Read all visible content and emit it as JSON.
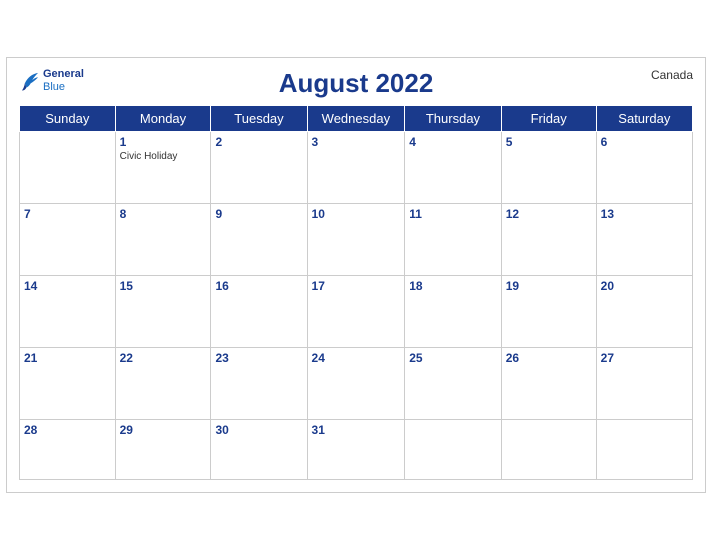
{
  "header": {
    "title": "August 2022",
    "country": "Canada",
    "logo_general": "General",
    "logo_blue": "Blue"
  },
  "days_of_week": [
    "Sunday",
    "Monday",
    "Tuesday",
    "Wednesday",
    "Thursday",
    "Friday",
    "Saturday"
  ],
  "weeks": [
    [
      {
        "date": "",
        "holiday": ""
      },
      {
        "date": "1",
        "holiday": "Civic Holiday"
      },
      {
        "date": "2",
        "holiday": ""
      },
      {
        "date": "3",
        "holiday": ""
      },
      {
        "date": "4",
        "holiday": ""
      },
      {
        "date": "5",
        "holiday": ""
      },
      {
        "date": "6",
        "holiday": ""
      }
    ],
    [
      {
        "date": "7",
        "holiday": ""
      },
      {
        "date": "8",
        "holiday": ""
      },
      {
        "date": "9",
        "holiday": ""
      },
      {
        "date": "10",
        "holiday": ""
      },
      {
        "date": "11",
        "holiday": ""
      },
      {
        "date": "12",
        "holiday": ""
      },
      {
        "date": "13",
        "holiday": ""
      }
    ],
    [
      {
        "date": "14",
        "holiday": ""
      },
      {
        "date": "15",
        "holiday": ""
      },
      {
        "date": "16",
        "holiday": ""
      },
      {
        "date": "17",
        "holiday": ""
      },
      {
        "date": "18",
        "holiday": ""
      },
      {
        "date": "19",
        "holiday": ""
      },
      {
        "date": "20",
        "holiday": ""
      }
    ],
    [
      {
        "date": "21",
        "holiday": ""
      },
      {
        "date": "22",
        "holiday": ""
      },
      {
        "date": "23",
        "holiday": ""
      },
      {
        "date": "24",
        "holiday": ""
      },
      {
        "date": "25",
        "holiday": ""
      },
      {
        "date": "26",
        "holiday": ""
      },
      {
        "date": "27",
        "holiday": ""
      }
    ],
    [
      {
        "date": "28",
        "holiday": ""
      },
      {
        "date": "29",
        "holiday": ""
      },
      {
        "date": "30",
        "holiday": ""
      },
      {
        "date": "31",
        "holiday": ""
      },
      {
        "date": "",
        "holiday": ""
      },
      {
        "date": "",
        "holiday": ""
      },
      {
        "date": "",
        "holiday": ""
      }
    ]
  ]
}
